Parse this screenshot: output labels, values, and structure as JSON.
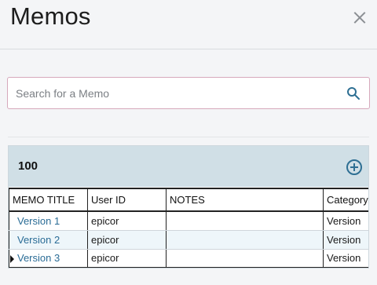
{
  "header": {
    "title": "Memos"
  },
  "search": {
    "placeholder": "Search for a Memo"
  },
  "grid": {
    "count": "100",
    "columns": [
      "MEMO TITLE",
      "User ID",
      "NOTES",
      "Category"
    ],
    "rows": [
      {
        "title": "Version 1",
        "user": "epicor",
        "notes": "",
        "category": "Version"
      },
      {
        "title": "Version 2",
        "user": "epicor",
        "notes": "",
        "category": "Version"
      },
      {
        "title": "Version 3",
        "user": "epicor",
        "notes": "",
        "category": "Version"
      }
    ]
  },
  "colors": {
    "accent": "#2e6f93",
    "link": "#2a6c96",
    "panel_header": "#d0dfe6"
  },
  "icons": {
    "close": "close-icon",
    "search": "search-icon",
    "add": "add-circle-icon",
    "row_pointer": "row-pointer-icon"
  }
}
